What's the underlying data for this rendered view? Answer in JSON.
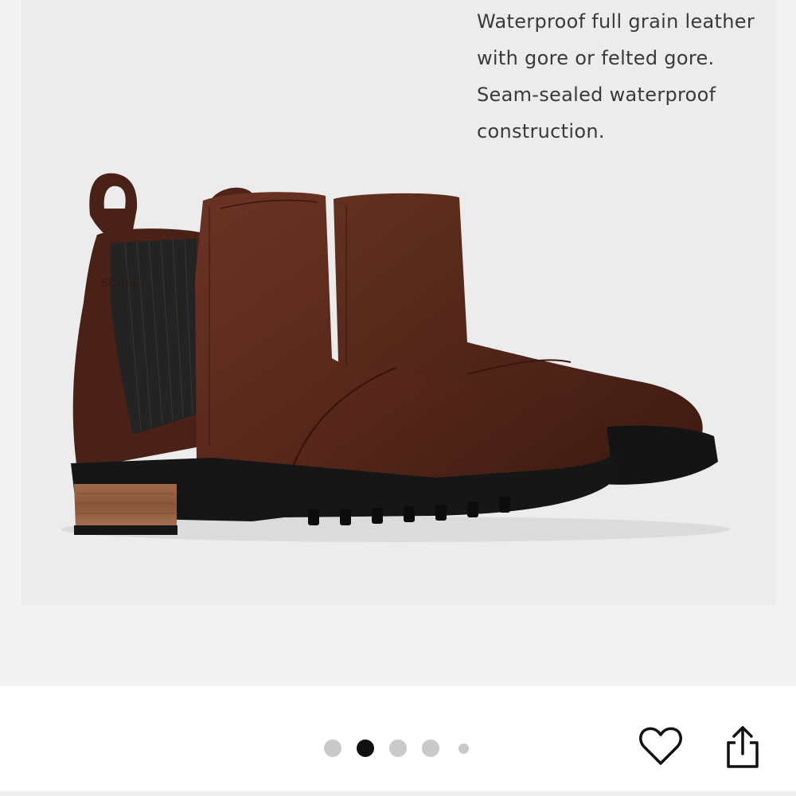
{
  "product_image": {
    "caption": "Waterproof full grain leather\nwith gore or felted gore.\nSeam-sealed waterproof\nconstruction."
  },
  "carousel": {
    "total": 5,
    "active_index": 1
  },
  "actions": {
    "favorite_icon": "heart-outline-icon",
    "share_icon": "share-icon"
  },
  "colors": {
    "gallery_background": "#f2f2f2",
    "image_background": "#ececec",
    "leather": "#5a2a1e",
    "active_dot": "#111111",
    "inactive_dot": "#c9c9c9"
  }
}
